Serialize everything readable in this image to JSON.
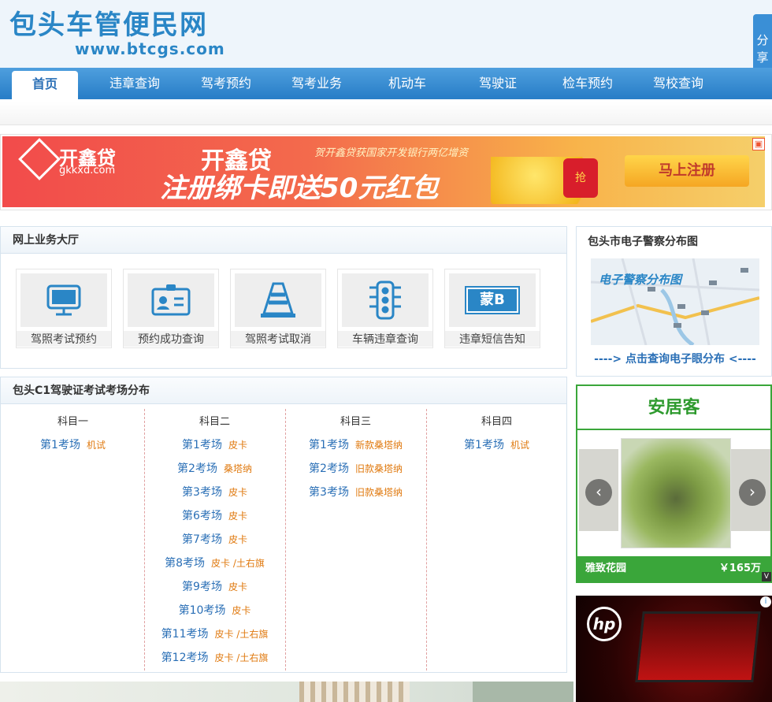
{
  "header": {
    "title": "包头车管便民网",
    "url": "www.btcgs.com",
    "share": "分享"
  },
  "nav": {
    "items": [
      "首页",
      "违章查询",
      "驾考预约",
      "驾考业务",
      "机动车",
      "驾驶证",
      "检车预约",
      "驾校查询"
    ]
  },
  "banner": {
    "brand": "开鑫贷",
    "brand_url": "gkkxd.com",
    "slogan_top": "开鑫贷",
    "slogan_main": "注册绑卡即送50元红包",
    "note": "贺开鑫贷获国家开发银行两亿增资",
    "button": "马上注册",
    "gift_char": "抢"
  },
  "services": {
    "title": "网上业务大厅",
    "items": [
      {
        "label": "驾照考试预约",
        "icon": "monitor-icon"
      },
      {
        "label": "预约成功查询",
        "icon": "id-card-icon"
      },
      {
        "label": "驾照考试取消",
        "icon": "traffic-cone-icon"
      },
      {
        "label": "车辆违章查询",
        "icon": "traffic-light-icon"
      },
      {
        "label": "违章短信告知",
        "icon": "license-plate-icon",
        "plate": "蒙B"
      }
    ]
  },
  "exam": {
    "title": "包头C1驾驶证考试考场分布",
    "columns": [
      {
        "head": "科目一",
        "sites": [
          {
            "name": "第1考场",
            "tag": "机试"
          }
        ]
      },
      {
        "head": "科目二",
        "sites": [
          {
            "name": "第1考场",
            "tag": "皮卡"
          },
          {
            "name": "第2考场",
            "tag": "桑塔纳"
          },
          {
            "name": "第3考场",
            "tag": "皮卡"
          },
          {
            "name": "第6考场",
            "tag": "皮卡"
          },
          {
            "name": "第7考场",
            "tag": "皮卡"
          },
          {
            "name": "第8考场",
            "tag": "皮卡 /土右旗"
          },
          {
            "name": "第9考场",
            "tag": "皮卡"
          },
          {
            "name": "第10考场",
            "tag": "皮卡"
          },
          {
            "name": "第11考场",
            "tag": "皮卡 /土右旗"
          },
          {
            "name": "第12考场",
            "tag": "皮卡 /土右旗"
          }
        ]
      },
      {
        "head": "科目三",
        "sites": [
          {
            "name": "第1考场",
            "tag": "新款桑塔纳"
          },
          {
            "name": "第2考场",
            "tag": "旧款桑塔纳"
          },
          {
            "name": "第3考场",
            "tag": "旧款桑塔纳"
          }
        ]
      },
      {
        "head": "科目四",
        "sites": [
          {
            "name": "第1考场",
            "tag": "机试"
          }
        ]
      }
    ]
  },
  "camera_map": {
    "title": "包头市电子警察分布图",
    "map_caption": "电子警察分布图",
    "link": "----> 点击查询电子眼分布 <----"
  },
  "anjuke": {
    "brand": "安居客",
    "listing": "雅致花园",
    "price": "￥165万",
    "corner": "V"
  },
  "hp_ad": {
    "logo": "hp",
    "info": "i"
  },
  "colors": {
    "accent": "#2a86c6",
    "nav": "#2a7fc8",
    "tag": "#e07a10",
    "green": "#3aa63a"
  }
}
